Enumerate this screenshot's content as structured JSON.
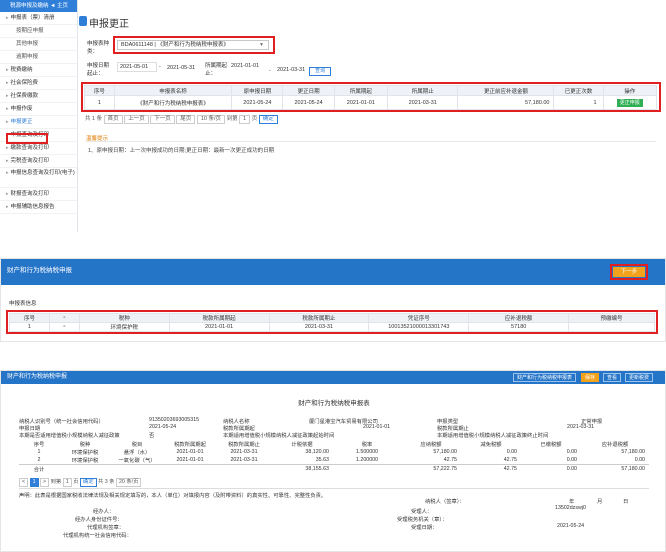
{
  "panel1": {
    "sidebar": {
      "header": "税源申报及缴纳  ◄ 主页",
      "items": [
        {
          "label": "申报表（票）清册",
          "level": "top"
        },
        {
          "label": "按期应申报",
          "level": "sub"
        },
        {
          "label": "其他申报",
          "level": "sub"
        },
        {
          "label": "逾期申报",
          "level": "sub"
        },
        {
          "label": "税费缴纳",
          "level": "top"
        },
        {
          "label": "社会保险费",
          "level": "top"
        },
        {
          "label": "社保费缴款",
          "level": "top"
        },
        {
          "label": "申报作废",
          "level": "top"
        },
        {
          "label": "申报更正",
          "level": "top",
          "active": true
        },
        {
          "label": "申报查询及打印",
          "level": "top"
        },
        {
          "label": "缴款查询及打印",
          "level": "top"
        },
        {
          "label": "完税查询及打印",
          "level": "top"
        },
        {
          "label": "申报信息查询及打印(电子)",
          "level": "top"
        },
        {
          "label": "财报查询及打印",
          "level": "top"
        },
        {
          "label": "申报辅助信息报告",
          "level": "top"
        }
      ]
    },
    "title": "申报更正",
    "form": {
      "type_label": "申报表种类：",
      "type_value": "BDA0611148 | 《财产和行为税纳税申报表》",
      "period_start_label": "申报日期起止：",
      "period_start_from": "2021-05-01",
      "period_start_to": "2021-05-31",
      "tax_period_label": "所属期起止：",
      "tax_period_from": "2021-01-01",
      "tax_period_to": "2021-03-31",
      "query_button": "查询"
    },
    "table": {
      "headers": [
        "序号",
        "申报表名称",
        "原申报日期",
        "更正日期",
        "所属期起",
        "所属期止",
        "更正前应补退金额",
        "已更正次数",
        "操作"
      ],
      "rows": [
        [
          "1",
          "《财产和行为税纳税申报表》",
          "2021-05-24",
          "2021-05-24",
          "2021-01-01",
          "2021-03-31",
          "57,180.00",
          "1",
          "更正申报"
        ]
      ]
    },
    "pager": {
      "total": "共 1 条",
      "first": "首页",
      "prev": "上一页",
      "next": "下一页",
      "last": "尾页",
      "page_size": "10 条/页",
      "goto": "到第",
      "page_no": "1",
      "page_suffix": "页",
      "confirm": "确定"
    },
    "tips": {
      "title": "温馨提示",
      "text": "1、原申报日期：上一次申报成功的日期;更正日期：最新一次更正成功的日期"
    }
  },
  "panel2": {
    "title": "财产和行为税纳税申报",
    "next_button": "下一步",
    "section_title": "申报表信息",
    "table": {
      "headers": [
        "序号",
        "",
        "税种",
        "税款所属期起",
        "税款所属期止",
        "凭证序号",
        "应补退税额",
        "预缴编号"
      ],
      "rows": [
        [
          "1",
          "",
          "环境保护税",
          "2021-01-01",
          "2021-03-31",
          "10013521000013301743",
          "57180",
          ""
        ]
      ]
    }
  },
  "panel3": {
    "bar_title": "财产和行为税纳税申报",
    "tabs": [
      "财产和行为税纳税申报表",
      "保存",
      "查看",
      "更新税费"
    ],
    "form_title": "财产和行为税纳税申报表",
    "kv": {
      "taxpayer_id_label": "纳税人识别号（统一社会信用代码）",
      "taxpayer_id": "91350203693005315",
      "taxpayer_name_label": "纳税人名称",
      "taxpayer_name": "厦门星港宝汽车贸易有限公司",
      "decl_type_label": "申报类型",
      "decl_type": "正常申报",
      "decl_date_label": "申报日期",
      "decl_date": "2021-05-24",
      "period_start_label": "税款所属期起",
      "period_start": "2021-01-01",
      "period_end_label": "税款所属期止",
      "period_end": "2021-03-31",
      "small_scale_label": "本期是否适用增值税小规模纳税人减征政策",
      "small_scale_value": "否",
      "small_scale_start_label": "本期适用增值税小规模纳税人减征政策起始时间",
      "small_scale_end_label": "本期适用增值税小规模纳税人减征政策终止时间"
    },
    "table": {
      "headers": [
        "序号",
        "税种",
        "税目",
        "税款所属期起",
        "税款所属期止",
        "计税依据",
        "税率",
        "应纳税额",
        "减免税额",
        "已缴税额",
        "应补退税额"
      ],
      "rows": [
        [
          "1",
          "环境保护税",
          "悬浮（水）",
          "2021-01-01",
          "2021-03-31",
          "38,120.00",
          "1.500000",
          "57,180.00",
          "0.00",
          "0.00",
          "57,180.00"
        ],
        [
          "2",
          "环境保护税",
          "一氧化碳（气）",
          "2021-01-01",
          "2021-03-31",
          "35.63",
          "1.200000",
          "42.75",
          "42.75",
          "0.00",
          "0.00"
        ],
        [
          "合计",
          "",
          "",
          "",
          "",
          "38,155.63",
          "",
          "57,222.75",
          "42.75",
          "0.00",
          "57,180.00"
        ]
      ]
    },
    "pager": {
      "goto": "到第",
      "page_no": "1",
      "page_suffix": "页",
      "confirm": "确定",
      "total": "共 3 条",
      "page_size": "20 条/页",
      "current": "1"
    },
    "declaration": "声明：此表是根据国家税收法律法规及相关规定填写的，本人（单位）对填报内容（及附带资料）的真实性、可靠性、完整性负责。",
    "sign": {
      "signer_label": "纳税人（签章）：",
      "year": "年",
      "month": "月",
      "day": "日",
      "agent_label": "经办人：",
      "agent_id_label": "经办人身份证件号：",
      "agency_label": "代理机构签章：",
      "agency_code_label": "代理机构统一社会信用代码：",
      "receiver_label": "受理人：",
      "receiver_value": "13502dzswj0",
      "receiver_org_label": "受理税务机关（章）：",
      "receive_date_label": "受理日期：",
      "receive_date": "2021-05-24"
    }
  },
  "colors": {
    "brand_blue": "#2474c8",
    "highlight_red": "#e02020",
    "next_orange": "#f3a21c",
    "update_green": "#2fae55"
  }
}
